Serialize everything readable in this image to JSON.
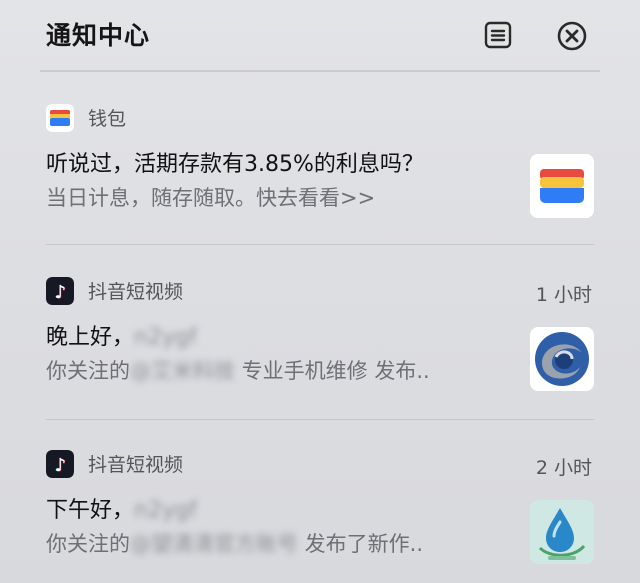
{
  "header": {
    "title": "通知中心",
    "list_icon": "list-icon",
    "close_icon": "close-circle-icon"
  },
  "notifications": [
    {
      "app": "钱包",
      "app_icon": "wallet-icon",
      "time": "",
      "title": "听说过，活期存款有3.85%的利息吗？",
      "body": "当日计息，随存随取。快去看看>>",
      "thumbnail": "wallet-card-thumbnail"
    },
    {
      "app": "抖音短视频",
      "app_icon": "douyin-icon",
      "time": "1 小时",
      "title_prefix": "晚上好，",
      "title_blurred": "n2ygf",
      "body_prefix": "你关注的",
      "body_blurred": "@艾米科技",
      "body_suffix": " 专业手机维修 发布..",
      "thumbnail": "avatar-swirl-logo"
    },
    {
      "app": "抖音短视频",
      "app_icon": "douyin-icon",
      "time": "2 小时",
      "title_prefix": "下午好，",
      "title_blurred": "n2ygf",
      "body_prefix": "你关注的",
      "body_blurred": "@望清清官方账号",
      "body_suffix": " 发布了新作..",
      "thumbnail": "avatar-water-drop"
    }
  ]
}
